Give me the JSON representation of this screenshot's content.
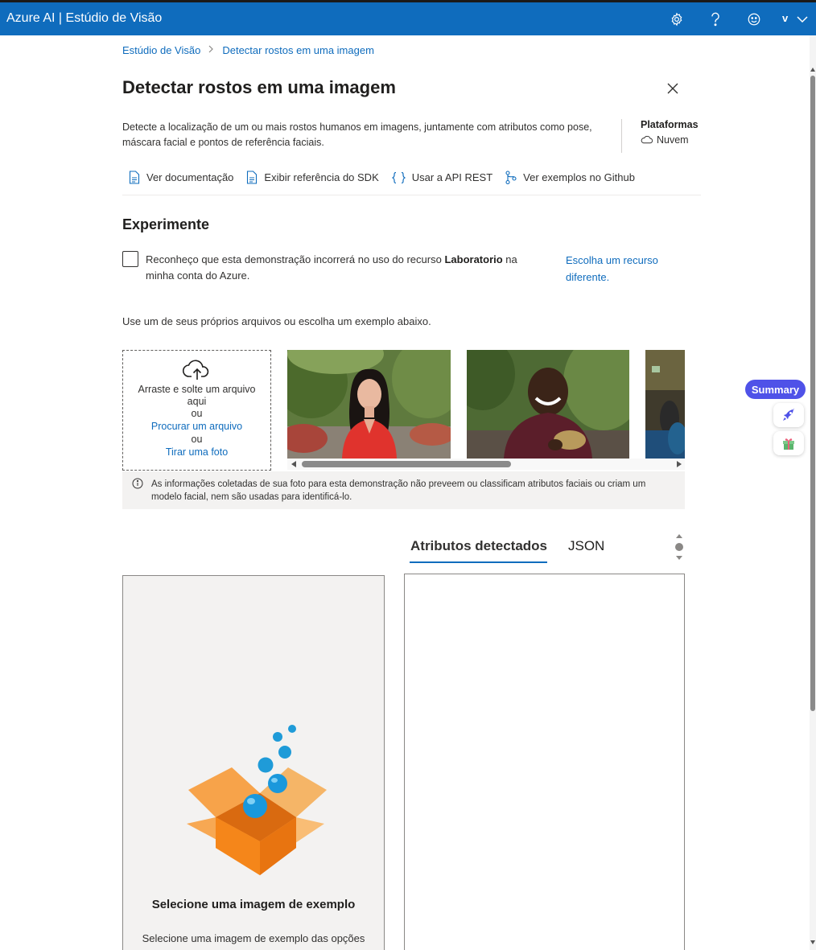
{
  "header": {
    "app_title": "Azure AI | Estúdio de Visão",
    "user_initial": "v",
    "icons": [
      "gear-icon",
      "help-icon",
      "smiley-icon",
      "chevron-down-icon"
    ],
    "brand_color": "#0f6cbd"
  },
  "breadcrumb": {
    "items": [
      "Estúdio de Visão",
      "Detectar rostos em uma imagem"
    ],
    "separator": ">"
  },
  "page": {
    "title": "Detectar rostos em uma imagem",
    "description": "Detecte a localização de um ou mais rostos humanos em imagens, juntamente com atributos como pose, máscara facial e pontos de referência faciais.",
    "platform_title": "Plataformas",
    "platform_value": "Nuvem"
  },
  "links": [
    {
      "label": "Ver documentação",
      "icon": "document-icon"
    },
    {
      "label": "Exibir referência do SDK",
      "icon": "document-icon"
    },
    {
      "label": "Usar a API REST",
      "icon": "braces-icon"
    },
    {
      "label": "Ver exemplos no Github",
      "icon": "branch-icon"
    }
  ],
  "experiment": {
    "title": "Experimente",
    "consent_prefix": "Reconheço que esta demonstração incorrerá no uso do recurso ",
    "consent_resource": "Laboratorio",
    "consent_suffix": " na minha conta do Azure.",
    "choose_resource_link": "Escolha um recurso diferente.",
    "checkbox_checked": false,
    "use_files_text": "Use um de seus próprios arquivos ou escolha um exemplo abaixo."
  },
  "dropzone": {
    "line1": "Arraste e solte um arquivo aqui",
    "or1": "ou",
    "browse_link": "Procurar um arquivo",
    "or2": "ou",
    "photo_link": "Tirar uma foto"
  },
  "info_text": "As informações coletadas de sua foto para esta demonstração não preveem ou classificam atributos faciais ou criam um modelo facial, nem são usadas para identificá-lo.",
  "tabs": [
    {
      "label": "Atributos detectados",
      "active": true
    },
    {
      "label": "JSON",
      "active": false
    }
  ],
  "empty_state": {
    "title": "Selecione uma imagem de exemplo",
    "subtitle": "Selecione uma imagem de exemplo das opções"
  },
  "sidebar_widget": {
    "summary_label": "Summary",
    "accent": "#4f52e8",
    "icons": [
      "rocket-icon",
      "gift-icon"
    ]
  }
}
